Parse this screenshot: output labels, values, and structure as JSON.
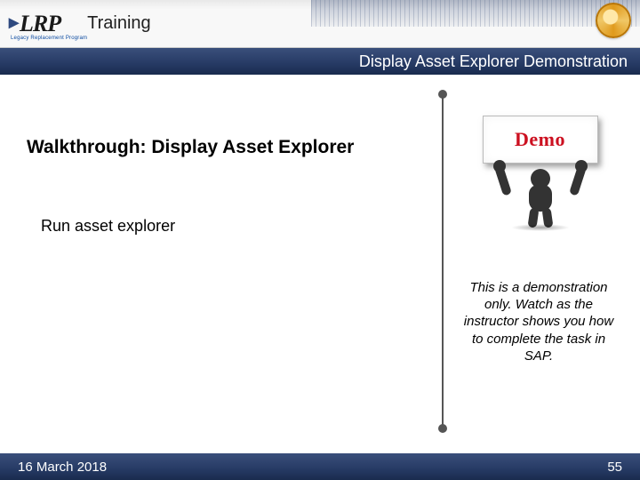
{
  "header": {
    "logo_text": "LRP",
    "logo_sub": "Legacy Replacement Program",
    "section_title": "Training"
  },
  "band": {
    "subtitle": "Display Asset Explorer Demonstration"
  },
  "main": {
    "walkthrough_label": "Walkthrough:  Display Asset Explorer",
    "run_line": "Run asset explorer",
    "demo_sign": "Demo",
    "note": "This is a demonstration only. Watch as the instructor shows you how to complete the task in SAP."
  },
  "footer": {
    "date": "16 March 2018",
    "page": "55"
  }
}
